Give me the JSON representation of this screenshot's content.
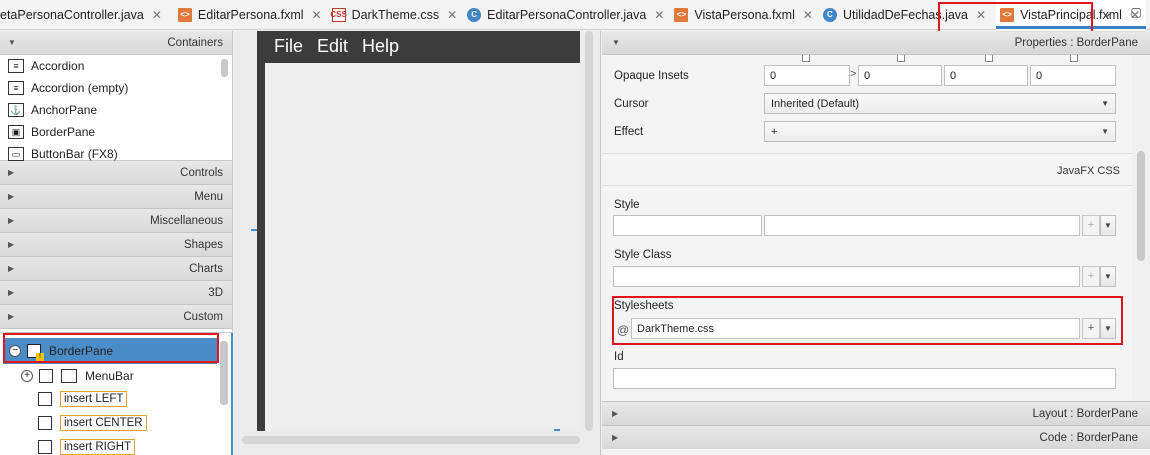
{
  "tabs": [
    {
      "label": "etaPersonaController.java",
      "icon": "java",
      "active": false
    },
    {
      "label": "EditarPersona.fxml",
      "icon": "fxml",
      "active": false
    },
    {
      "label": "DarkTheme.css",
      "icon": "css",
      "active": false
    },
    {
      "label": "EditarPersonaController.java",
      "icon": "java",
      "active": false
    },
    {
      "label": "VistaPersona.fxml",
      "icon": "fxml",
      "active": false
    },
    {
      "label": "UtilidadDeFechas.java",
      "icon": "java",
      "active": false
    },
    {
      "label": "VistaPrincipal.fxml",
      "icon": "fxml",
      "active": true
    }
  ],
  "library": {
    "containers_header": "Containers",
    "items": [
      {
        "label": "Accordion",
        "icon": "accordion-icon"
      },
      {
        "label": "Accordion  (empty)",
        "icon": "accordion-icon"
      },
      {
        "label": "AnchorPane",
        "icon": "anchor-icon"
      },
      {
        "label": "BorderPane",
        "icon": "borderpane-icon"
      },
      {
        "label": "ButtonBar  (FX8)",
        "icon": "buttonbar-icon"
      }
    ],
    "sections": [
      "Controls",
      "Menu",
      "Miscellaneous",
      "Shapes",
      "Charts",
      "3D",
      "Custom"
    ]
  },
  "hierarchy": {
    "root": "BorderPane",
    "menubar": "MenuBar",
    "insert_left": "insert LEFT",
    "insert_center": "insert CENTER",
    "insert_right": "insert RIGHT"
  },
  "canvas": {
    "menu": [
      "File",
      "Edit",
      "Help"
    ]
  },
  "inspector": {
    "properties_header": "Properties : BorderPane",
    "opaque_insets_label": "Opaque Insets",
    "opaque_insets": [
      "0",
      "0",
      "0",
      "0"
    ],
    "cursor_label": "Cursor",
    "cursor_value": "Inherited (Default)",
    "effect_label": "Effect",
    "effect_value": "+",
    "css_section": "JavaFX CSS",
    "style_label": "Style",
    "style_class_label": "Style Class",
    "stylesheets_label": "Stylesheets",
    "stylesheet_value": "DarkTheme.css",
    "id_label": "Id",
    "plus": "+",
    "at": "@",
    "chevron": ">",
    "layout_header": "Layout : BorderPane",
    "code_header": "Code : BorderPane"
  },
  "colors": {
    "highlight": "#e0161e",
    "selection": "#4a8cc8",
    "canvas_dark": "#3c3c3c"
  }
}
